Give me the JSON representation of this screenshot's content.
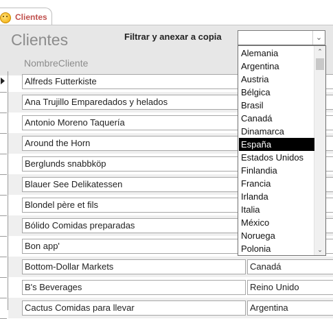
{
  "tab": {
    "label": "Clientes",
    "icon": "smiley-icon"
  },
  "form": {
    "title": "Clientes",
    "filter_label": "Filtrar y anexar a copia",
    "column_header": "NombreCliente"
  },
  "combo": {
    "value": "",
    "arrow": "⌄"
  },
  "dropdown": {
    "selected": "España",
    "options": [
      "Alemania",
      "Argentina",
      "Austria",
      "Bélgica",
      "Brasil",
      "Canadá",
      "Dinamarca",
      "España",
      "Estados Unidos",
      "Finlandia",
      "Francia",
      "Irlanda",
      "Italia",
      "México",
      "Noruega",
      "Polonia"
    ],
    "scroll_up": "⌃",
    "scroll_down": "⌄"
  },
  "records": [
    {
      "name": "Alfreds Futterkiste",
      "country": ""
    },
    {
      "name": "Ana Trujillo Emparedados y helados",
      "country": ""
    },
    {
      "name": "Antonio Moreno Taquería",
      "country": ""
    },
    {
      "name": "Around the Horn",
      "country": ""
    },
    {
      "name": "Berglunds snabbköp",
      "country": ""
    },
    {
      "name": "Blauer See Delikatessen",
      "country": ""
    },
    {
      "name": "Blondel père et fils",
      "country": ""
    },
    {
      "name": "Bólido Comidas preparadas",
      "country": ""
    },
    {
      "name": "Bon app'",
      "country": ""
    },
    {
      "name": "Bottom-Dollar Markets",
      "country": "Canadá"
    },
    {
      "name": "B's Beverages",
      "country": "Reino Unido"
    },
    {
      "name": "Cactus Comidas para llevar",
      "country": "Argentina"
    }
  ],
  "colors": {
    "tab_text": "#c0504d",
    "header_bg": "#e7e7e7",
    "title_text": "#8c8c8c",
    "selection": "#000000"
  }
}
